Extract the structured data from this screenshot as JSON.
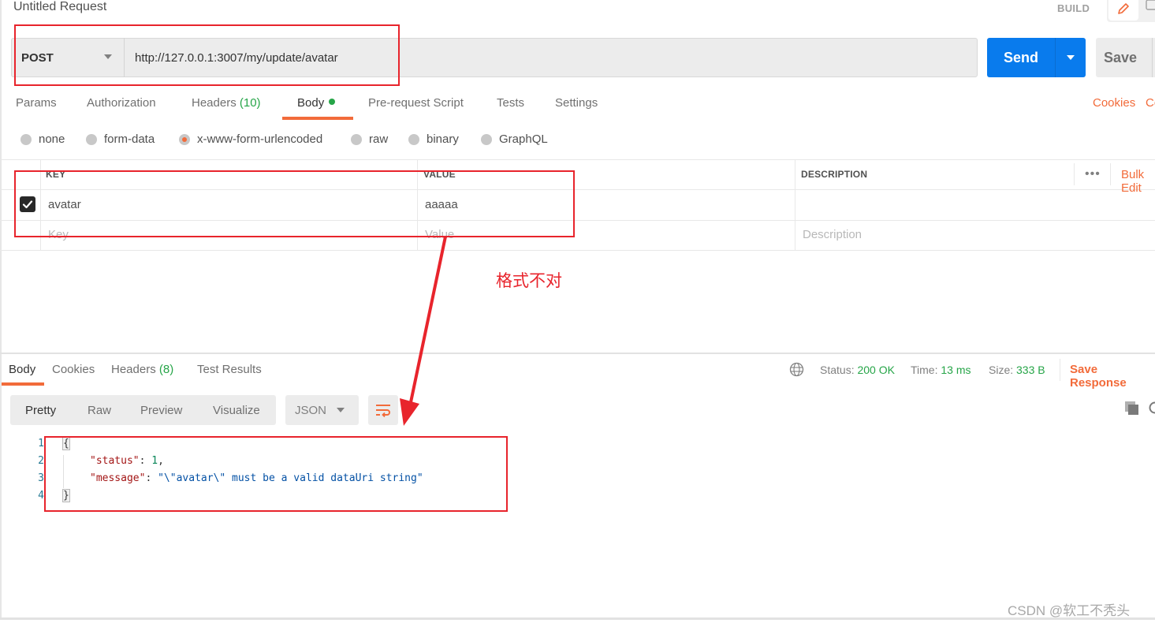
{
  "request": {
    "title": "Untitled Request",
    "build_label": "BUILD",
    "method": "POST",
    "url": "http://127.0.0.1:3007/my/update/avatar",
    "send_label": "Send",
    "save_label": "Save"
  },
  "request_tabs": [
    {
      "label": "Params"
    },
    {
      "label": "Authorization"
    },
    {
      "label": "Headers",
      "count": "(10)"
    },
    {
      "label": "Body",
      "active": true
    },
    {
      "label": "Pre-request Script"
    },
    {
      "label": "Tests"
    },
    {
      "label": "Settings"
    }
  ],
  "links": {
    "cookies": "Cookies",
    "code": "Code"
  },
  "body_types": [
    {
      "label": "none"
    },
    {
      "label": "form-data"
    },
    {
      "label": "x-www-form-urlencoded",
      "selected": true
    },
    {
      "label": "raw"
    },
    {
      "label": "binary"
    },
    {
      "label": "GraphQL"
    }
  ],
  "params_table": {
    "headers": {
      "key": "KEY",
      "value": "VALUE",
      "description": "DESCRIPTION"
    },
    "more_label": "•••",
    "bulk_edit_label": "Bulk Edit",
    "rows": [
      {
        "checked": true,
        "key": "avatar",
        "value": "aaaaa",
        "description": ""
      }
    ],
    "placeholders": {
      "key": "Key",
      "value": "Value",
      "description": "Description"
    }
  },
  "annotation": {
    "text": "格式不对",
    "color": "#e8242c"
  },
  "response_tabs": [
    {
      "label": "Body",
      "active": true
    },
    {
      "label": "Cookies"
    },
    {
      "label": "Headers",
      "count": "(8)"
    },
    {
      "label": "Test Results"
    }
  ],
  "response_meta": {
    "status_label": "Status:",
    "status_value": "200 OK",
    "time_label": "Time:",
    "time_value": "13 ms",
    "size_label": "Size:",
    "size_value": "333 B",
    "save_response_label": "Save Response"
  },
  "view_modes": [
    {
      "label": "Pretty",
      "active": true
    },
    {
      "label": "Raw"
    },
    {
      "label": "Preview"
    },
    {
      "label": "Visualize"
    }
  ],
  "format": "JSON",
  "response_body": {
    "line_numbers": [
      "1",
      "2",
      "3",
      "4"
    ],
    "open_brace": "{",
    "close_brace": "}",
    "status_key": "\"status\"",
    "status_value": "1",
    "message_key": "\"message\"",
    "message_value": "\"\\\"avatar\\\" must be a valid dataUri string\""
  },
  "watermark": "CSDN @软工不秃头",
  "colors": {
    "accent": "#f26b3a",
    "send_blue": "#097bed",
    "success_green": "#26a548",
    "annotation_red": "#e8242c"
  }
}
